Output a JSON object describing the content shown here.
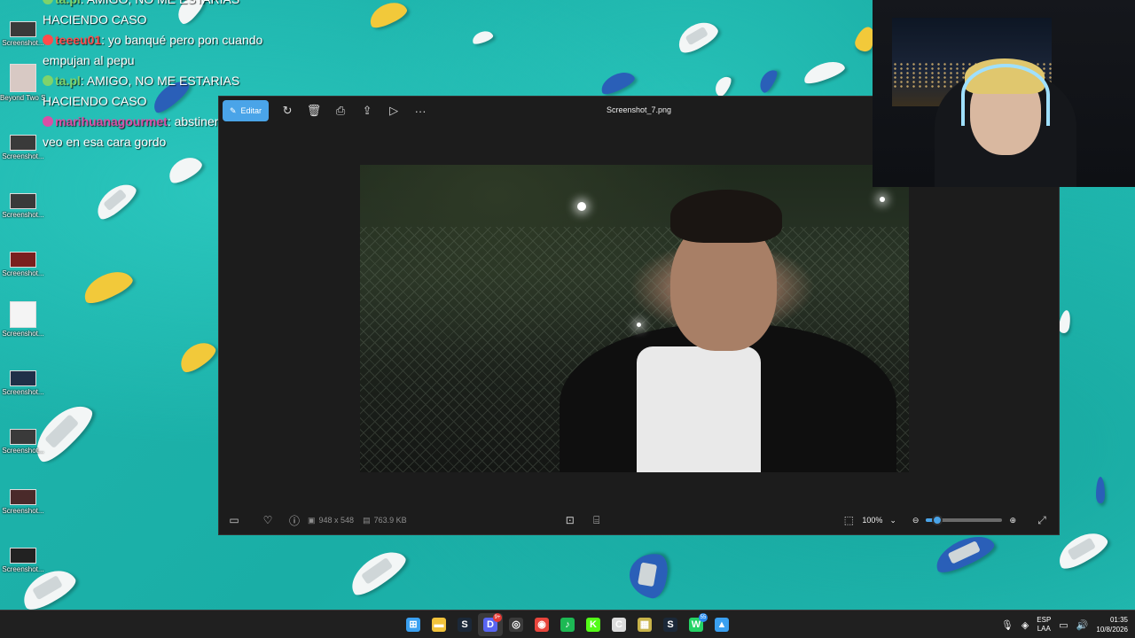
{
  "chat": {
    "lines": [
      {
        "user": "ta.pl",
        "text": ": AMIGO, NO ME ESTARIAS",
        "user_color": "#7fd36b"
      },
      {
        "user": "",
        "text": "HACIENDO CASO",
        "user_color": "#ffffff"
      },
      {
        "user": "teeeu01",
        "text": ": yo banqué pero pon cuando",
        "user_color": "#ff4b4b"
      },
      {
        "user": "",
        "text": "empujan al pepu",
        "user_color": "#ffffff"
      },
      {
        "user": "ta.pl",
        "text": ": AMIGO, NO ME ESTARIAS",
        "user_color": "#7fd36b"
      },
      {
        "user": "",
        "text": "HACIENDO CASO",
        "user_color": "#ffffff"
      },
      {
        "user": "marihuanagourmet",
        "text": ": abstinencia es lo que",
        "user_color": "#d94fa5"
      },
      {
        "user": "",
        "text": "veo en esa cara gordo",
        "user_color": "#ffffff"
      }
    ]
  },
  "desktop": {
    "icons": [
      {
        "label": "Screenshot..."
      },
      {
        "label": "Beyond Two Souls"
      },
      {
        "label": "Screenshot..."
      },
      {
        "label": "Screenshot..."
      },
      {
        "label": "Screenshot..."
      },
      {
        "label": "Screenshot..."
      },
      {
        "label": "Screenshot..."
      },
      {
        "label": "Screenshot..."
      },
      {
        "label": "Screenshot..."
      },
      {
        "label": "Screenshot..."
      }
    ]
  },
  "photos_app": {
    "title": "Screenshot_7.png",
    "edit_label": "Editar",
    "toolbar_icons": [
      "rotate-icon",
      "delete-icon",
      "print-icon",
      "share-icon",
      "slideshow-icon",
      "more-icon"
    ],
    "dimensions": "948 x 548",
    "file_size": "763.9 KB",
    "zoom": "100%",
    "zoom_level": 0.15
  },
  "taskbar": {
    "apps": [
      {
        "name": "start",
        "glyph": "⊞",
        "color": "#3aa0f0",
        "badge": ""
      },
      {
        "name": "file-explorer",
        "glyph": "▬",
        "color": "#f2c33b",
        "badge": ""
      },
      {
        "name": "steam",
        "glyph": "S",
        "color": "#1b2838",
        "badge": ""
      },
      {
        "name": "discord",
        "glyph": "D",
        "color": "#5865f2",
        "badge": "9+"
      },
      {
        "name": "obs",
        "glyph": "◎",
        "color": "#3b3b3b",
        "badge": ""
      },
      {
        "name": "chrome",
        "glyph": "◉",
        "color": "#e8453c",
        "badge": ""
      },
      {
        "name": "spotify",
        "glyph": "♪",
        "color": "#1db954",
        "badge": ""
      },
      {
        "name": "kick",
        "glyph": "K",
        "color": "#53fc18",
        "badge": ""
      },
      {
        "name": "cursor",
        "glyph": "C",
        "color": "#dddddd",
        "badge": ""
      },
      {
        "name": "game",
        "glyph": "▦",
        "color": "#c9b44a",
        "badge": ""
      },
      {
        "name": "steam-2",
        "glyph": "S",
        "color": "#1b2838",
        "badge": ""
      },
      {
        "name": "whatsapp",
        "glyph": "W",
        "color": "#25d366",
        "badge": "55"
      },
      {
        "name": "photos",
        "glyph": "▲",
        "color": "#3aa0f0",
        "badge": ""
      }
    ],
    "language": "ESP",
    "layout": "LAA",
    "time": "01:35",
    "date": "10/8/2026"
  }
}
